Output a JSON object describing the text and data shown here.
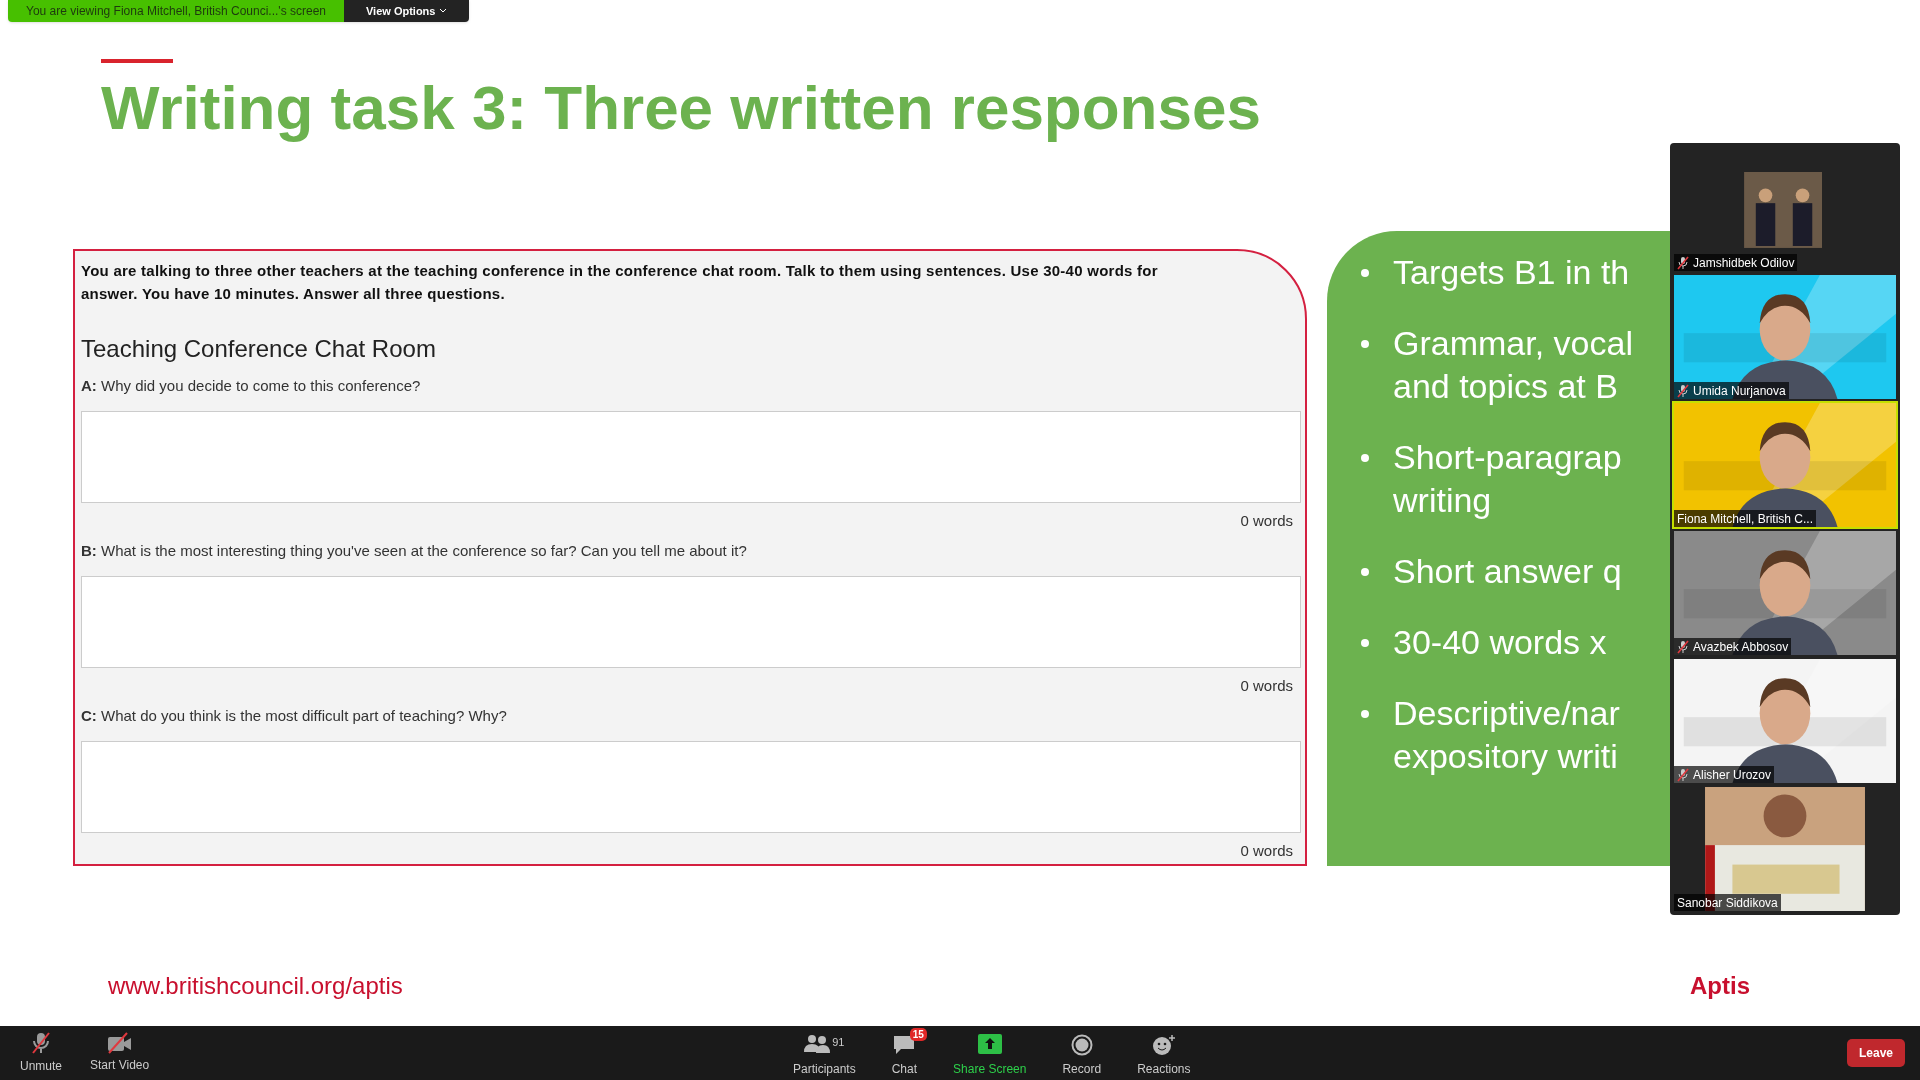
{
  "share_banner": {
    "text": "You are viewing Fiona Mitchell, British Counci...'s screen",
    "view_options": "View Options"
  },
  "slide": {
    "title": "Writing task 3: Three written responses",
    "task": {
      "instructions": "You are talking to three other teachers at the teaching conference in the conference chat room. Talk to them using sentences. Use 30-40 words for",
      "instructions_line2": "answer. You have 10 minutes. Answer all three questions.",
      "heading": "Teaching Conference Chat Room",
      "questions": [
        {
          "text": "**A:** Why did you decide to come to this conference?",
          "count": "0 words"
        },
        {
          "text": "**B:** What is the most interesting thing you've seen at the conference so far? Can you tell me about it?",
          "count": "0 words"
        },
        {
          "text": "**C:** What do you think is the most difficult part of teaching? Why?",
          "count": "0 words"
        }
      ]
    },
    "bullets": [
      {
        "lines": [
          "Targets B1 in th"
        ]
      },
      {
        "lines": [
          "Grammar, vocal",
          "and topics at B"
        ]
      },
      {
        "lines": [
          "Short-paragrap",
          "writing"
        ]
      },
      {
        "lines": [
          "Short answer q"
        ]
      },
      {
        "lines": [
          "30-40 words x"
        ]
      },
      {
        "lines": [
          "Descriptive/nar",
          "expository writi"
        ]
      }
    ],
    "url": "www.britishcouncil.org/aptis",
    "brand": "Aptis"
  },
  "videos": [
    {
      "name": "Jamshidbek Odilov",
      "muted": true,
      "speaking": false,
      "kind": "thumbnail"
    },
    {
      "name": "Umida Nurjanova",
      "muted": true,
      "speaking": false,
      "kind": "camera"
    },
    {
      "name": "Fiona Mitchell, British C...",
      "muted": false,
      "speaking": true,
      "kind": "camera"
    },
    {
      "name": "Avazbek Abbosov",
      "muted": true,
      "speaking": false,
      "kind": "camera"
    },
    {
      "name": "Alisher Urozov",
      "muted": true,
      "speaking": false,
      "kind": "camera"
    },
    {
      "name": "Sanobar Siddikova",
      "muted": false,
      "speaking": false,
      "kind": "portrait"
    }
  ],
  "toolbar": {
    "left": [
      {
        "label": "Unmute",
        "kind": "mic"
      },
      {
        "label": "Start Video",
        "kind": "video"
      }
    ],
    "center": [
      {
        "label": "Participants",
        "kind": "participants",
        "count": "91"
      },
      {
        "label": "Chat",
        "kind": "chat",
        "badge": "15"
      },
      {
        "label": "Share Screen",
        "kind": "share"
      },
      {
        "label": "Record",
        "kind": "record"
      },
      {
        "label": "Reactions",
        "kind": "reactions"
      }
    ],
    "leave": "Leave"
  }
}
